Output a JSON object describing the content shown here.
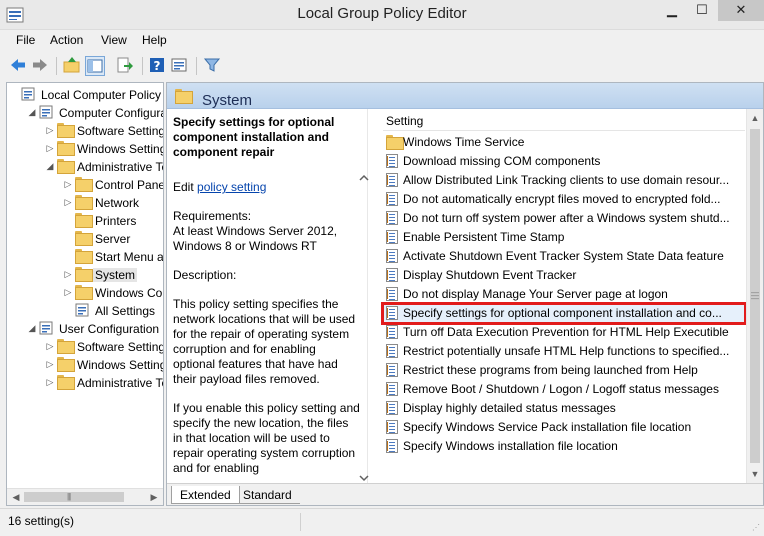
{
  "window": {
    "title": "Local Group Policy Editor",
    "min_glyph": "▁",
    "max_glyph": "☐",
    "close_glyph": "✕"
  },
  "menu": [
    "File",
    "Action",
    "View",
    "Help"
  ],
  "toolbar": {
    "buttons": [
      "back-arrow-icon",
      "forward-arrow-icon",
      "up-folder-icon",
      "show-hide-tree-icon",
      "export-list-icon",
      "help-icon",
      "properties-icon",
      "filter-icon"
    ]
  },
  "tree": {
    "items": [
      {
        "label": "Local Computer Policy",
        "expander": "",
        "icon": "computer-policy-icon"
      },
      {
        "label": "Computer Configura",
        "expander": "◢",
        "icon": "computer-icon"
      },
      {
        "label": "Software Settings",
        "expander": "▷",
        "icon": "folder-icon"
      },
      {
        "label": "Windows Setting",
        "expander": "▷",
        "icon": "folder-icon"
      },
      {
        "label": "Administrative Te",
        "expander": "◢",
        "icon": "folder-icon"
      },
      {
        "label": "Control Panel",
        "expander": "▷",
        "icon": "folder-icon"
      },
      {
        "label": "Network",
        "expander": "▷",
        "icon": "folder-icon"
      },
      {
        "label": "Printers",
        "expander": "",
        "icon": "folder-icon"
      },
      {
        "label": "Server",
        "expander": "",
        "icon": "folder-icon"
      },
      {
        "label": "Start Menu ar",
        "expander": "",
        "icon": "folder-icon"
      },
      {
        "label": "System",
        "expander": "▷",
        "icon": "folder-icon",
        "selected": true
      },
      {
        "label": "Windows Cor",
        "expander": "▷",
        "icon": "folder-icon"
      },
      {
        "label": "All Settings",
        "expander": "",
        "icon": "all-settings-icon"
      },
      {
        "label": "User Configuration",
        "expander": "◢",
        "icon": "user-icon"
      },
      {
        "label": "Software Settings",
        "expander": "▷",
        "icon": "folder-icon"
      },
      {
        "label": "Windows Setting",
        "expander": "▷",
        "icon": "folder-icon"
      },
      {
        "label": "Administrative Te",
        "expander": "▷",
        "icon": "folder-icon"
      }
    ]
  },
  "right": {
    "header_title": "System",
    "description": {
      "policy_title": "Specify settings for optional component installation and component repair",
      "edit_prefix": "Edit ",
      "edit_link": "policy setting",
      "requirements_label": "Requirements:",
      "requirements_text": "At least Windows Server 2012, Windows 8 or Windows RT",
      "description_label": "Description:",
      "description_text": "This policy setting specifies the network locations that will be used for the repair of operating system corruption and for enabling optional features that have had their payload files removed.",
      "description_text2": "If you enable this policy setting and specify the new location, the files in that location will be used to repair operating system corruption and for enabling"
    },
    "list": {
      "column_header": "Setting",
      "rows": [
        {
          "label": "Windows Time Service",
          "icon": "folder-icon"
        },
        {
          "label": "Download missing COM components",
          "icon": "policy-icon"
        },
        {
          "label": "Allow Distributed Link Tracking clients to use domain resour...",
          "icon": "policy-icon"
        },
        {
          "label": "Do not automatically encrypt files moved to encrypted fold...",
          "icon": "policy-icon"
        },
        {
          "label": "Do not turn off system power after a Windows system shutd...",
          "icon": "policy-icon"
        },
        {
          "label": "Enable Persistent Time Stamp",
          "icon": "policy-icon"
        },
        {
          "label": "Activate Shutdown Event Tracker System State Data feature",
          "icon": "policy-icon"
        },
        {
          "label": "Display Shutdown Event Tracker",
          "icon": "policy-icon"
        },
        {
          "label": "Do not display Manage Your Server page at logon",
          "icon": "policy-icon"
        },
        {
          "label": "Specify settings for optional component installation and co...",
          "icon": "policy-icon",
          "selected": true
        },
        {
          "label": "Turn off Data Execution Prevention for HTML Help Executible",
          "icon": "policy-icon"
        },
        {
          "label": "Restrict potentially unsafe HTML Help functions to specified...",
          "icon": "policy-icon"
        },
        {
          "label": "Restrict these programs from being launched from Help",
          "icon": "policy-icon"
        },
        {
          "label": "Remove Boot / Shutdown / Logon / Logoff status messages",
          "icon": "policy-icon"
        },
        {
          "label": "Display highly detailed status messages",
          "icon": "policy-icon"
        },
        {
          "label": "Specify Windows Service Pack installation file location",
          "icon": "policy-icon"
        },
        {
          "label": "Specify Windows installation file location",
          "icon": "policy-icon"
        }
      ]
    },
    "tabs": [
      "Extended",
      "Standard"
    ]
  },
  "status": {
    "text": "16 setting(s)"
  },
  "colors": {
    "selection_outline": "#e21b1b",
    "header_gradient_top": "#cfe0f2",
    "link": "#0645ad"
  }
}
